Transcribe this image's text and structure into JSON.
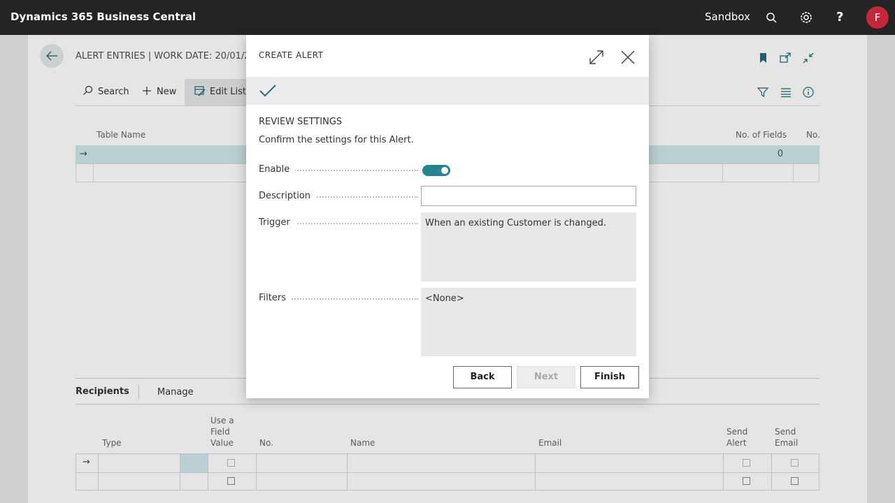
{
  "topbar": {
    "app_title": "Dynamics 365 Business Central",
    "environment": "Sandbox",
    "avatar_initial": "F",
    "avatar_color": "#c4263a"
  },
  "page": {
    "title": "ALERT ENTRIES | WORK DATE: 20/01/20",
    "actions": {
      "search": "Search",
      "new": "New",
      "edit_list": "Edit List"
    },
    "columns": {
      "table_name": "Table Name",
      "no_of_fields": "No. of Fields",
      "no": "No."
    },
    "selected_row": {
      "no_of_fields": "0"
    },
    "recipients": {
      "title": "Recipients",
      "manage": "Manage",
      "columns": {
        "type": "Type",
        "use_field_value": [
          "Use a",
          "Field",
          "Value"
        ],
        "no": "No.",
        "name": "Name",
        "email": "Email",
        "send_alert": [
          "Send",
          "Alert"
        ],
        "send_email": [
          "Send",
          "Email"
        ]
      }
    }
  },
  "dialog": {
    "title": "CREATE ALERT",
    "section_title": "REVIEW SETTINGS",
    "section_desc": "Confirm the settings for this Alert.",
    "fields": {
      "enable_label": "Enable",
      "enable_value": true,
      "description_label": "Description",
      "description_value": "",
      "trigger_label": "Trigger",
      "trigger_value": "When an existing Customer is changed.",
      "filters_label": "Filters",
      "filters_value": "<None>"
    },
    "buttons": {
      "back": "Back",
      "next": "Next",
      "finish": "Finish"
    },
    "accent_color": "#248491"
  }
}
